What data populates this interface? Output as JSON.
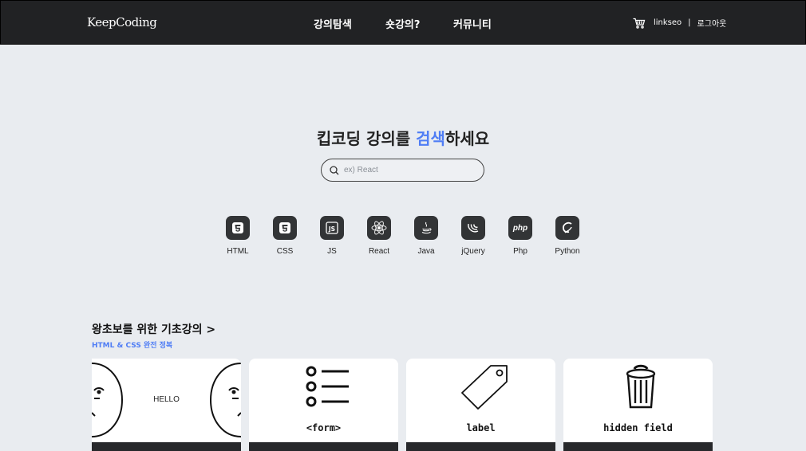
{
  "header": {
    "logo": "KeepCoding",
    "menu": [
      "강의탐색",
      "숏강의?",
      "커뮤니티"
    ],
    "cart_icon": "cart-icon",
    "username": "linkseo",
    "separator": "|",
    "logout": "로그아웃"
  },
  "hero": {
    "title_before": "킵코딩 강의를 ",
    "title_highlight": "검색",
    "title_after": "하세요",
    "highlight_color": "#4f7df5"
  },
  "search": {
    "placeholder": "ex) React",
    "value": ""
  },
  "languages": [
    {
      "label": "HTML",
      "icon": "html5-icon"
    },
    {
      "label": "CSS",
      "icon": "css3-icon"
    },
    {
      "label": "JS",
      "icon": "javascript-icon"
    },
    {
      "label": "React",
      "icon": "react-icon"
    },
    {
      "label": "Java",
      "icon": "java-icon"
    },
    {
      "label": "jQuery",
      "icon": "jquery-icon"
    },
    {
      "label": "Php",
      "icon": "php-icon",
      "icon_text": "php"
    },
    {
      "label": "Python",
      "icon": "python-icon"
    }
  ],
  "section": {
    "title": "왕초보를 위한 기초강의 >",
    "subtitle": "HTML & CSS 완전 정복"
  },
  "cards": [
    {
      "caption": "HELLO",
      "icon": "faces-illustration"
    },
    {
      "caption": "<form>",
      "icon": "list-icon"
    },
    {
      "caption": "label",
      "icon": "tag-icon"
    },
    {
      "caption": "hidden field",
      "icon": "trash-icon"
    }
  ]
}
